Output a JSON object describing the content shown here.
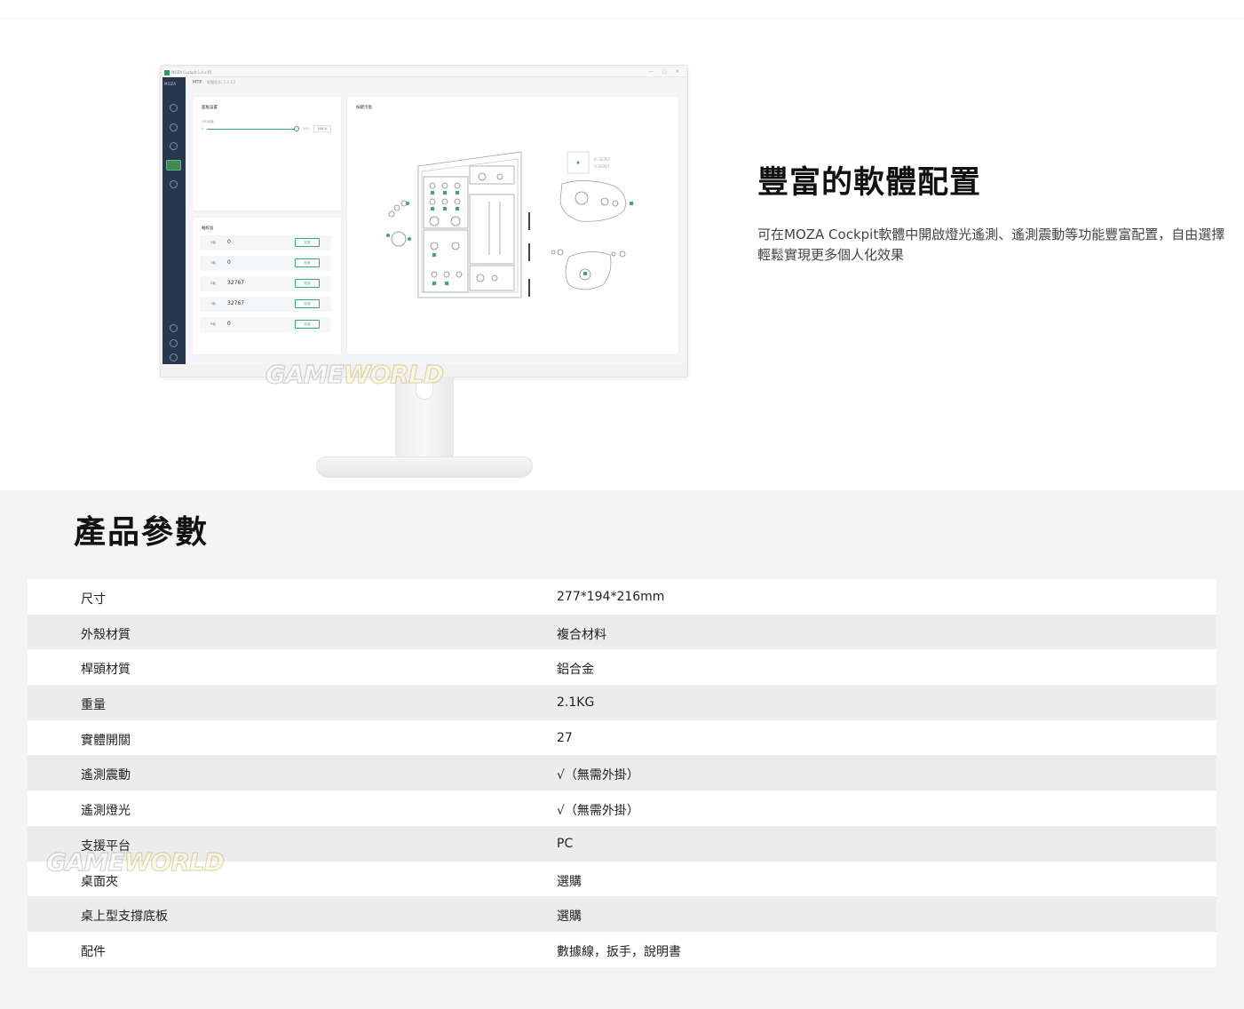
{
  "app_window": {
    "title": "MOZA Cockpit 1.4.x P1",
    "brand": "MOZA",
    "device": "MTP",
    "firmware": "韌體版本: 1.4.1.2",
    "window_controls": [
      "—",
      "□",
      "✕"
    ]
  },
  "panel_settings": {
    "title": "面板設置",
    "slider_label": "LED亮度",
    "slider_min": "0",
    "slider_max": "100",
    "slider_value": "100 %",
    "level": 1.0
  },
  "axis_calibration": {
    "title": "軸校准",
    "calibrate_label": "校准",
    "rows": [
      {
        "label": "X軸",
        "value": "0"
      },
      {
        "label": "Y軸",
        "value": "0"
      },
      {
        "label": "Z軸",
        "value": "32767"
      },
      {
        "label": "T軸",
        "value": "32767"
      },
      {
        "label": "R軸",
        "value": "0"
      }
    ]
  },
  "button_display": {
    "title": "按鍵示意",
    "x_readout": "X: 32767",
    "y_readout": "Y: 32767"
  },
  "watermark": {
    "part1": "GAME",
    "part2": "WORLD"
  },
  "feature": {
    "title": "豐富的軟體配置",
    "description": "可在MOZA Cockpit軟體中開啟燈光遙測、遙測震動等功能豐富配置，自由選擇輕鬆實現更多個人化效果"
  },
  "specs": {
    "title": "產品參數",
    "rows": [
      {
        "key": "尺寸",
        "value": "277*194*216mm"
      },
      {
        "key": "外殼材質",
        "value": "複合材料"
      },
      {
        "key": "桿頭材質",
        "value": "鋁合金"
      },
      {
        "key": "重量",
        "value": "2.1KG"
      },
      {
        "key": "實體開關",
        "value": "27"
      },
      {
        "key": "遙測震動",
        "value": "√（無需外掛）"
      },
      {
        "key": "遙測燈光",
        "value": "√（無需外掛）"
      },
      {
        "key": "支援平台",
        "value": "PC"
      },
      {
        "key": "桌面夾",
        "value": "選購"
      },
      {
        "key": "桌上型支撐底板",
        "value": "選購"
      },
      {
        "key": "配件",
        "value": "數據線，扳手，說明書"
      }
    ]
  },
  "colors": {
    "accent": "#3aaa6c",
    "sidebar": "#27374d",
    "spec_alt_row": "#ececec",
    "section_bg": "#f4f4f4"
  }
}
